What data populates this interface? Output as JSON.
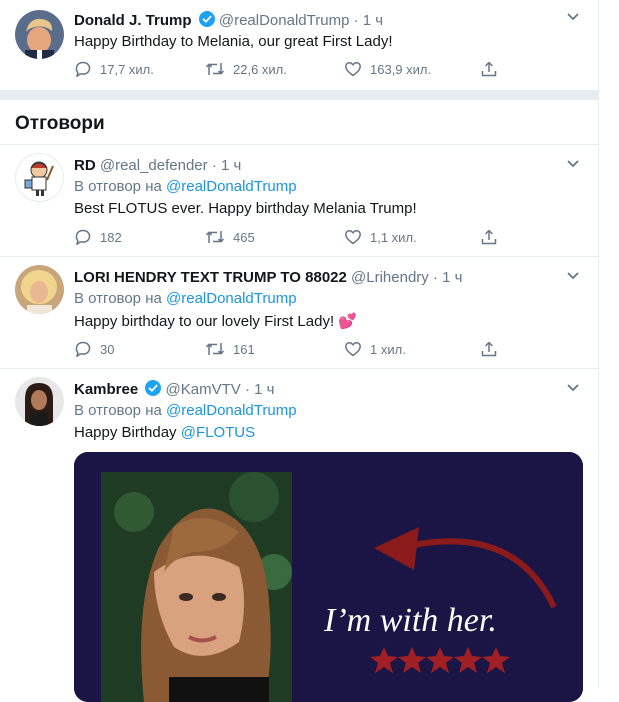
{
  "main_tweet": {
    "name": "Donald J. Trump",
    "handle": "@realDonaldTrump",
    "dot": "·",
    "time": "1 ч",
    "text": "Happy Birthday to Melania, our great First Lady!",
    "replies": "17,7 хил.",
    "retweets": "22,6 хил.",
    "likes": "163,9 хил."
  },
  "section_title": "Отговори",
  "replies": [
    {
      "name": "RD",
      "handle": "@real_defender",
      "dot": "·",
      "time": "1 ч",
      "replying_prefix": "В отговор на",
      "replying_to": "@realDonaldTrump",
      "text": "Best FLOTUS ever. Happy birthday Melania Trump!",
      "replies": "182",
      "retweets": "465",
      "likes": "1,1 хил."
    },
    {
      "name": "LORI HENDRY TEXT TRUMP TO 88022",
      "handle": "@Lrihendry",
      "dot": "·",
      "time": "1 ч",
      "replying_prefix": "В отговор на",
      "replying_to": "@realDonaldTrump",
      "text": "Happy birthday to our lovely First Lady! ",
      "emoji": "💕",
      "replies": "30",
      "retweets": "161",
      "likes": "1 хил."
    },
    {
      "name": "Kambree",
      "handle": "@KamVTV",
      "dot": "·",
      "time": "1 ч",
      "replying_prefix": "В отговор на",
      "replying_to": "@realDonaldTrump",
      "text": "Happy Birthday ",
      "mention": "@FLOTUS",
      "image_caption": "I’m with her."
    }
  ],
  "icons": {
    "reply": "reply-icon",
    "retweet": "retweet-icon",
    "like": "heart-icon",
    "share": "share-icon",
    "verified": "verified-badge-icon",
    "more": "chevron-down-icon"
  },
  "colors": {
    "link": "#1b95e0",
    "verified": "#1da1f2",
    "secondary_text": "#657786",
    "divider": "#e6ecf0",
    "image_bg": "#1a1544",
    "arrow": "#8b1a1a",
    "stars": "#a01f24"
  }
}
